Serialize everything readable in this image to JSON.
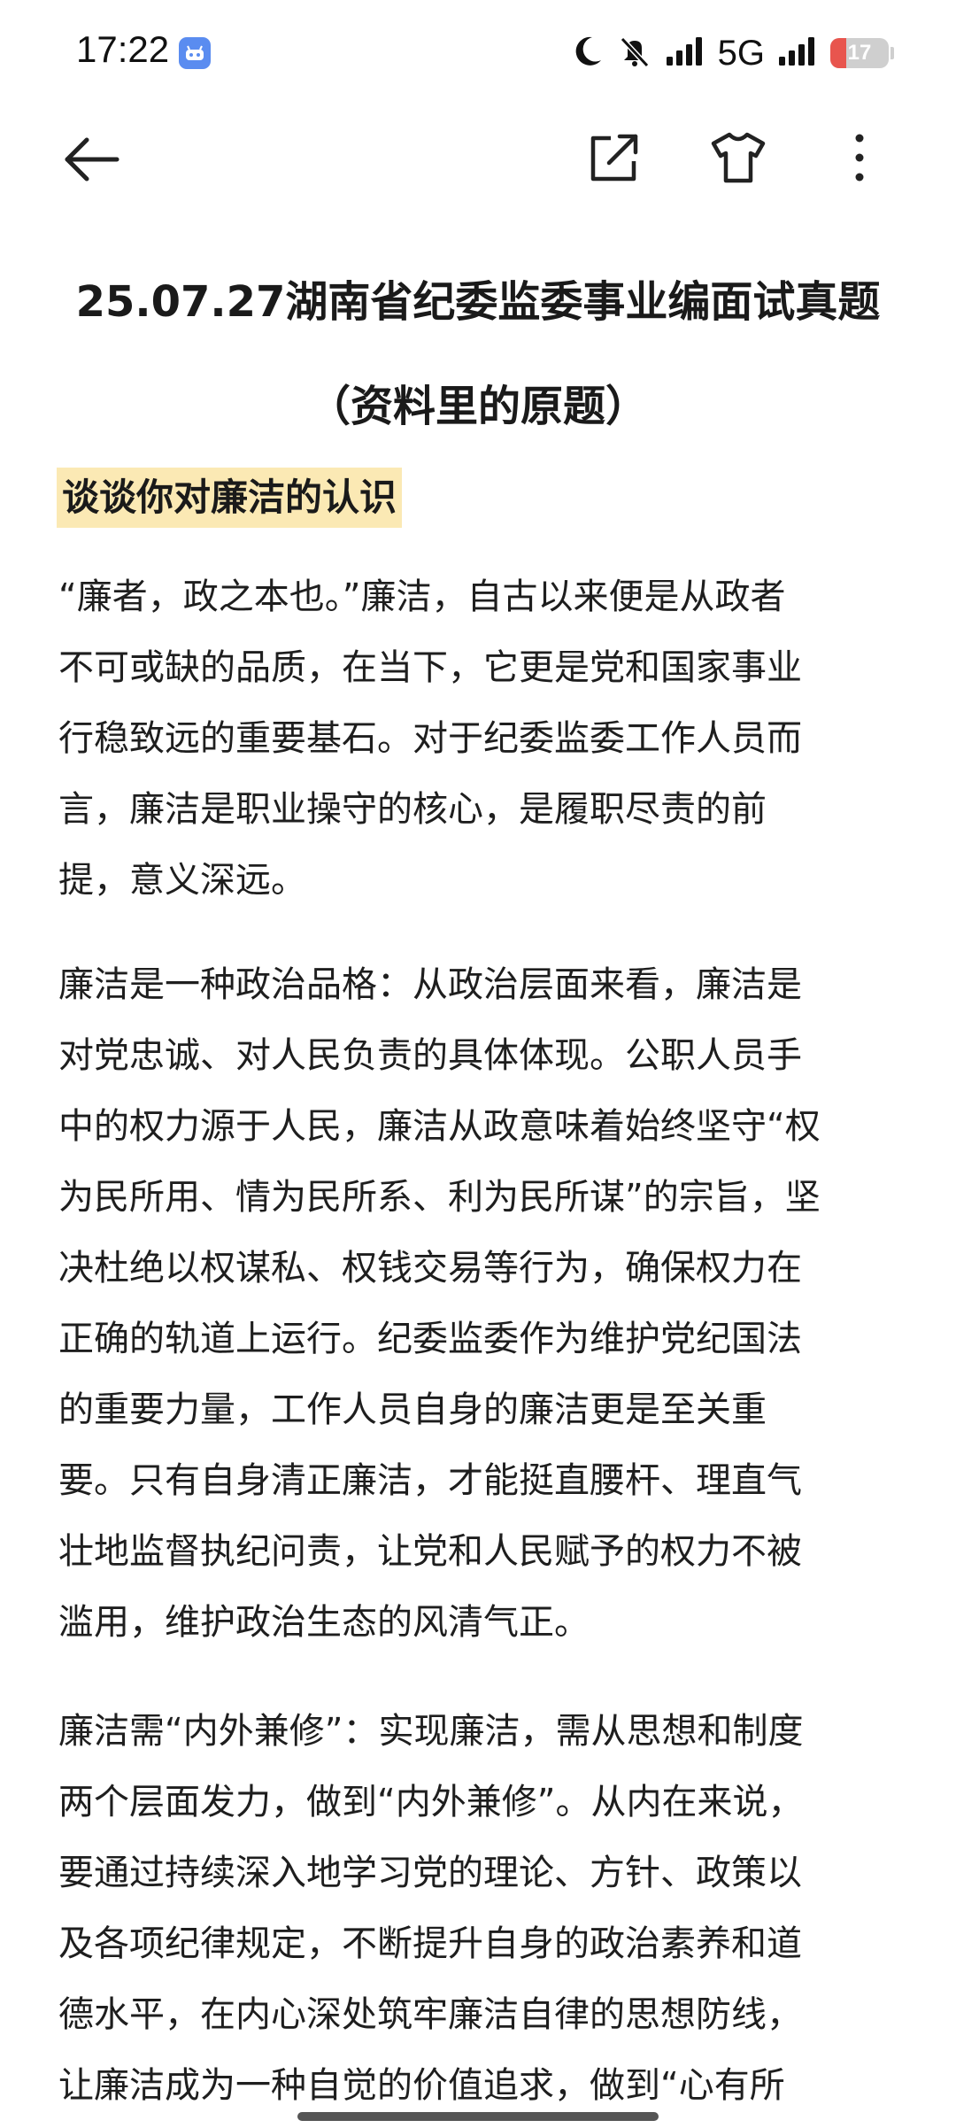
{
  "status_bar": {
    "time": "17:22",
    "network": "5G",
    "battery_level": 17,
    "battery_text": "17",
    "icons": [
      "moon-icon",
      "mute-icon",
      "signal-icon",
      "signal-icon",
      "battery-icon"
    ],
    "colors": {
      "battery_low": "#e8554e",
      "app_icon": "#5a8cf0"
    }
  },
  "nav": {
    "icons": [
      "back-arrow-icon",
      "share-icon",
      "shirt-icon",
      "more-vertical-icon"
    ]
  },
  "article": {
    "title_lines": [
      "25.07.27湖南省纪委监委事业编面试真题",
      "（资料里的原题）"
    ],
    "question": "谈谈你对廉洁的认识",
    "question_highlight": "#fbe9b4",
    "paragraphs": [
      {
        "lines": [
          "“廉者，政之本也。”廉洁，自古以来便是从政者",
          "不可或缺的品质，在当下，它更是党和国家事业",
          "行稳致远的重要基石。对于纪委监委工作人员而",
          "言，廉洁是职业操守的核心，是履职尽责的前",
          "提，意义深远。"
        ]
      },
      {
        "lines": [
          "廉洁是一种政治品格：从政治层面来看，廉洁是",
          "对党忠诚、对人民负责的具体体现。公职人员手",
          "中的权力源于人民，廉洁从政意味着始终坚守“权",
          "为民所用、情为民所系、利为民所谋”的宗旨，坚",
          "决杜绝以权谋私、权钱交易等行为，确保权力在",
          "正确的轨道上运行。纪委监委作为维护党纪国法",
          "的重要力量，工作人员自身的廉洁更是至关重",
          "要。只有自身清正廉洁，才能挺直腰杆、理直气",
          "壮地监督执纪问责，让党和人民赋予的权力不被",
          "滥用，维护政治生态的风清气正。"
        ]
      },
      {
        "lines": [
          "廉洁需“内外兼修”：实现廉洁，需从思想和制度",
          "两个层面发力，做到“内外兼修”。从内在来说，",
          "要通过持续深入地学习党的理论、方针、政策以",
          "及各项纪律规定，不断提升自身的政治素养和道",
          "德水平，在内心深处筑牢廉洁自律的思想防线，",
          "让廉洁成为一种自觉的价值追求，做到“心有所"
        ]
      }
    ]
  }
}
